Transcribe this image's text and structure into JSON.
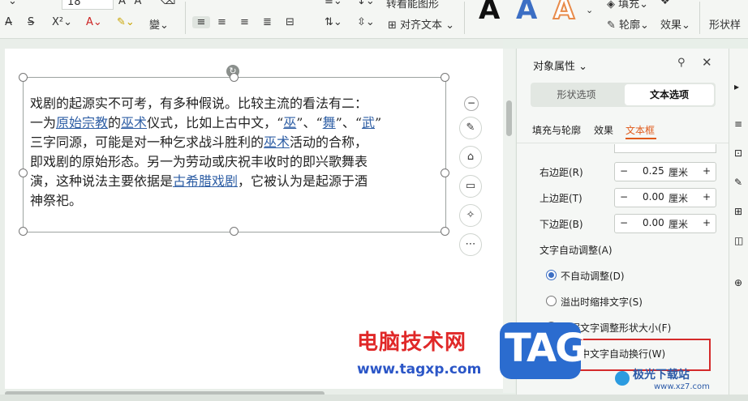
{
  "toolbar": {
    "font_size": "18",
    "align_text_label": "对齐文本",
    "convert_shape_label": "转看能图形",
    "fill_label": "填充",
    "outline_label": "轮廓",
    "effect_label": "效果",
    "shape_label": "形状样"
  },
  "document": {
    "line1": "戏剧的起源实不可考，有多种假说。比较主流的看法有二：",
    "line2_pre": "一为",
    "link1": "原始宗教",
    "line2_mid": "的",
    "link2": "巫术",
    "line2_post": "仪式，比如上古中文，“",
    "link3": "巫",
    "line2_sep1": "”、“",
    "link4": "舞",
    "line2_sep2": "”、“",
    "link5": "武",
    "line2_end": "”",
    "line3_pre": "三字同源，可能是对一种乞求战斗胜利的",
    "link6": "巫术",
    "line3_post": "活动的合称，",
    "line4": "即戏剧的原始形态。另一为劳动或庆祝丰收时的即兴歌舞表",
    "line5_pre": "演，这种说法主要依据是",
    "link7": "古希腊戏剧",
    "line5_post": "，它被认为是起源于酒",
    "line6": "神祭祀。"
  },
  "panel": {
    "title": "对象属性",
    "tab_shape": "形状选项",
    "tab_text": "文本选项",
    "subtab_fill": "填充与轮廓",
    "subtab_effect": "效果",
    "subtab_textbox": "文本框",
    "right_margin_label": "右边距(R)",
    "right_margin_value": "0.25",
    "top_margin_label": "上边距(T)",
    "top_margin_value": "0.00",
    "bottom_margin_label": "下边距(B)",
    "bottom_margin_value": "0.00",
    "unit": "厘米",
    "autofit_heading": "文字自动调整(A)",
    "option_no_autofit": "不自动调整(D)",
    "option_shrink": "溢出时缩排文字(S)",
    "option_resize": "根据文字调整形状大小(F)",
    "option_wrap": "形状中文字自动换行(W)"
  },
  "watermark": {
    "site_name": "电脑技术网",
    "site_url": "www.tagxp.com",
    "tag_logo": "TAG",
    "corner_site": "极光下载站",
    "corner_url": "www.xz7.com"
  },
  "colors": {
    "accent": "#2f5fa5",
    "highlight_box": "#d42a2a",
    "active_tab": "#e05a1a"
  }
}
